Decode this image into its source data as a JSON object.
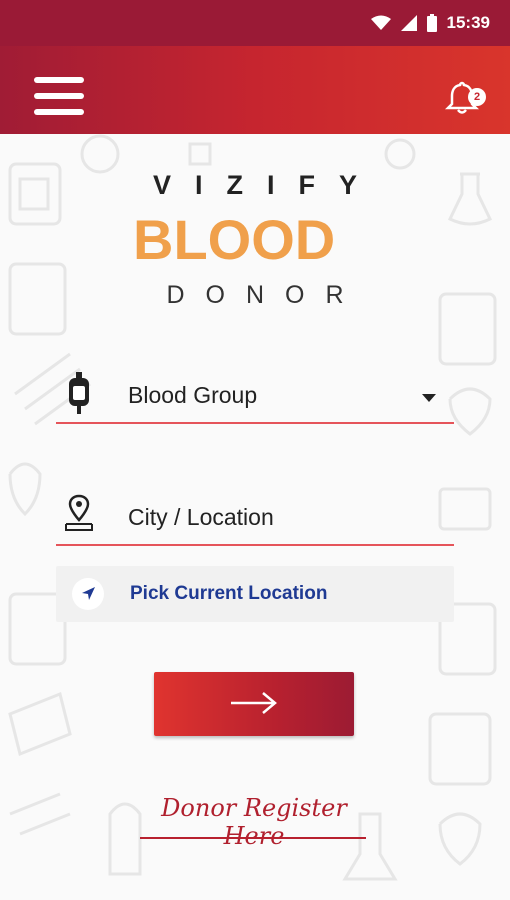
{
  "status_bar": {
    "time": "15:39"
  },
  "app_bar": {
    "notification_count": "2"
  },
  "logo": {
    "top": "VIZIFY",
    "middle": "BLOOD",
    "bottom": "DONOR"
  },
  "form": {
    "blood_group_label": "Blood Group",
    "location_label": "City / Location",
    "pick_location_label": "Pick Current Location"
  },
  "register_link": "Donor Register Here",
  "colors": {
    "primary_dark": "#9a1a36",
    "primary": "#c6252f",
    "accent_link": "#1f3a93",
    "logo_orange": "#f0a04b"
  },
  "icons": [
    "wifi-icon",
    "cell-signal-icon",
    "battery-icon",
    "menu-icon",
    "bell-icon",
    "blood-bag-icon",
    "location-pin-icon",
    "navigation-arrow-icon",
    "arrow-right-icon"
  ]
}
